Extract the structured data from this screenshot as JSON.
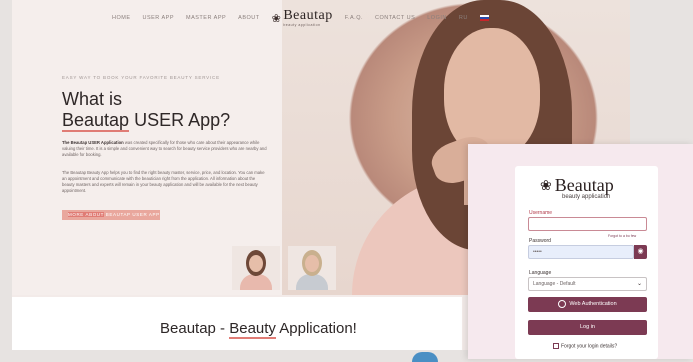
{
  "nav": {
    "items": [
      "HOME",
      "USER APP",
      "MASTER APP",
      "ABOUT"
    ],
    "items_right": [
      "F.A.Q.",
      "CONTACT US",
      "LOGIN",
      "RU"
    ],
    "logo_name": "Beautap",
    "logo_tagline": "beauty application"
  },
  "hero": {
    "eyebrow": "EASY WAY TO BOOK YOUR FAVORITE BEAUTY SERVICE",
    "title_line1": "What is",
    "title_brand": "Beautap",
    "title_rest": " USER App?",
    "para1_bold": "The Beautap USER Application",
    "para1_text": " was created specifically for those who care about their appearance while valuing their time. It is a simple and convenient way to search for beauty service providers who are nearby and available for booking.",
    "para2": "The Beautap Beauty App helps you to find the right beauty master, service, price, and location. You can make an appointment and communicate with the beautician right from the application. All information about the beauty masters and experts will remain in your beauty application and will be available for the next beauty appointment.",
    "cta_highlight": "MORE ABOUT",
    "cta_rest": " BEAUTAP USER APP"
  },
  "banner": {
    "brand": "Beautap",
    "dash": " - ",
    "highlight": "Beauty",
    "rest": " Application!"
  },
  "login": {
    "logo_name": "Beautap",
    "logo_tagline": "beauty application",
    "username_label": "Username",
    "username_value": "",
    "forgot_password": "Forgot to a bo few",
    "password_label": "Password",
    "password_value": "•••••",
    "language_label": "Language",
    "language_value": "Language - Default",
    "web_auth_label": "Web Authentication",
    "login_button": "Log in",
    "forgot_login": "Forgot your login details?"
  },
  "colors": {
    "accent": "#7c3a53",
    "highlight": "#e07c75"
  }
}
